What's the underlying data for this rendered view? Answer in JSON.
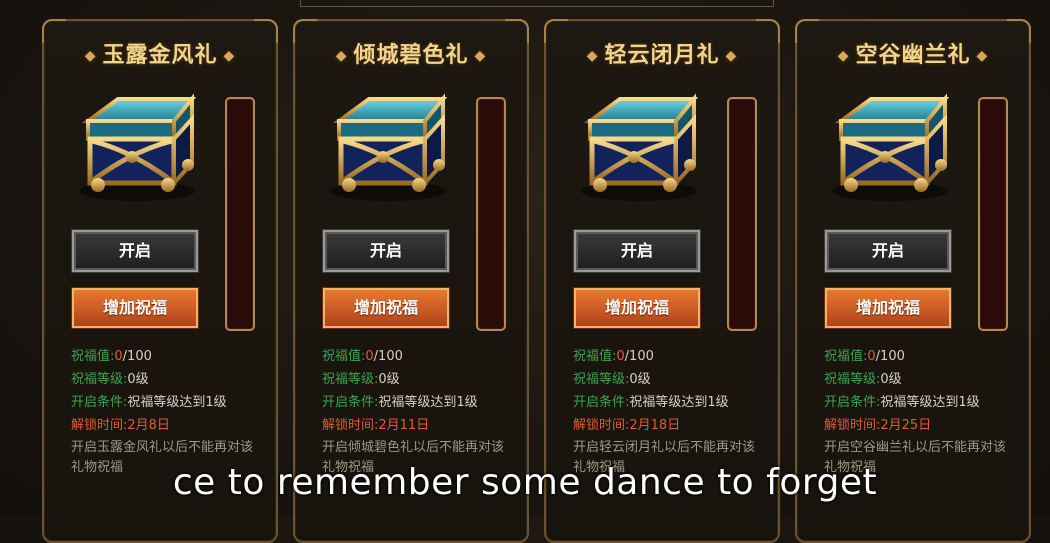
{
  "cards": [
    {
      "title": "玉露金风礼",
      "open_label": "开启",
      "bless_label": "增加祝福",
      "bless_value_label": "祝福值:",
      "bless_value": "0",
      "bless_max": "/100",
      "bless_level_label": "祝福等级:",
      "bless_level": "0级",
      "condition_label": "开启条件:",
      "condition": "祝福等级达到1级",
      "unlock_label": "解锁时间:",
      "unlock": "2月8日",
      "note": "开启玉露金风礼以后不能再对该礼物祝福",
      "progress": 0
    },
    {
      "title": "倾城碧色礼",
      "open_label": "开启",
      "bless_label": "增加祝福",
      "bless_value_label": "祝福值:",
      "bless_value": "0",
      "bless_max": "/100",
      "bless_level_label": "祝福等级:",
      "bless_level": "0级",
      "condition_label": "开启条件:",
      "condition": "祝福等级达到1级",
      "unlock_label": "解锁时间:",
      "unlock": "2月11日",
      "note": "开启倾城碧色礼以后不能再对该礼物祝福",
      "progress": 0
    },
    {
      "title": "轻云闭月礼",
      "open_label": "开启",
      "bless_label": "增加祝福",
      "bless_value_label": "祝福值:",
      "bless_value": "0",
      "bless_max": "/100",
      "bless_level_label": "祝福等级:",
      "bless_level": "0级",
      "condition_label": "开启条件:",
      "condition": "祝福等级达到1级",
      "unlock_label": "解锁时间:",
      "unlock": "2月18日",
      "note": "开启轻云闭月礼以后不能再对该礼物祝福",
      "progress": 0
    },
    {
      "title": "空谷幽兰礼",
      "open_label": "开启",
      "bless_label": "增加祝福",
      "bless_value_label": "祝福值:",
      "bless_value": "0",
      "bless_max": "/100",
      "bless_level_label": "祝福等级:",
      "bless_level": "0级",
      "condition_label": "开启条件:",
      "condition": "祝福等级达到1级",
      "unlock_label": "解锁时间:",
      "unlock": "2月25日",
      "note": "开启空谷幽兰礼以后不能再对该礼物祝福",
      "progress": 0
    }
  ],
  "subtitle": "ce to remember some dance to forget",
  "colors": {
    "label_green": "#3fa34d",
    "value_red": "#e25a35",
    "title_gold": "#f3d48c",
    "bless_orange": "#e8782e"
  },
  "icons": {
    "chest": "treasure-chest-icon",
    "title_ornament": "diamond-dot-icon"
  }
}
